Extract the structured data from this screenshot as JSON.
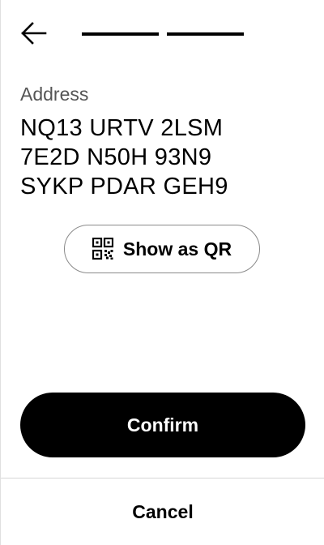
{
  "header": {
    "back_icon": "arrow-left-icon",
    "progress_steps": 2
  },
  "address": {
    "label": "Address",
    "lines": [
      "NQ13 URTV 2LSM",
      "7E2D N50H 93N9",
      "SYKP PDAR GEH9"
    ]
  },
  "qr_button": {
    "icon": "qr-code-icon",
    "label": "Show as QR"
  },
  "actions": {
    "confirm_label": "Confirm",
    "cancel_label": "Cancel"
  },
  "colors": {
    "primary": "#000000",
    "background": "#ffffff",
    "label": "#555555",
    "border": "#8a8a8a",
    "divider": "#d6d6d6"
  }
}
